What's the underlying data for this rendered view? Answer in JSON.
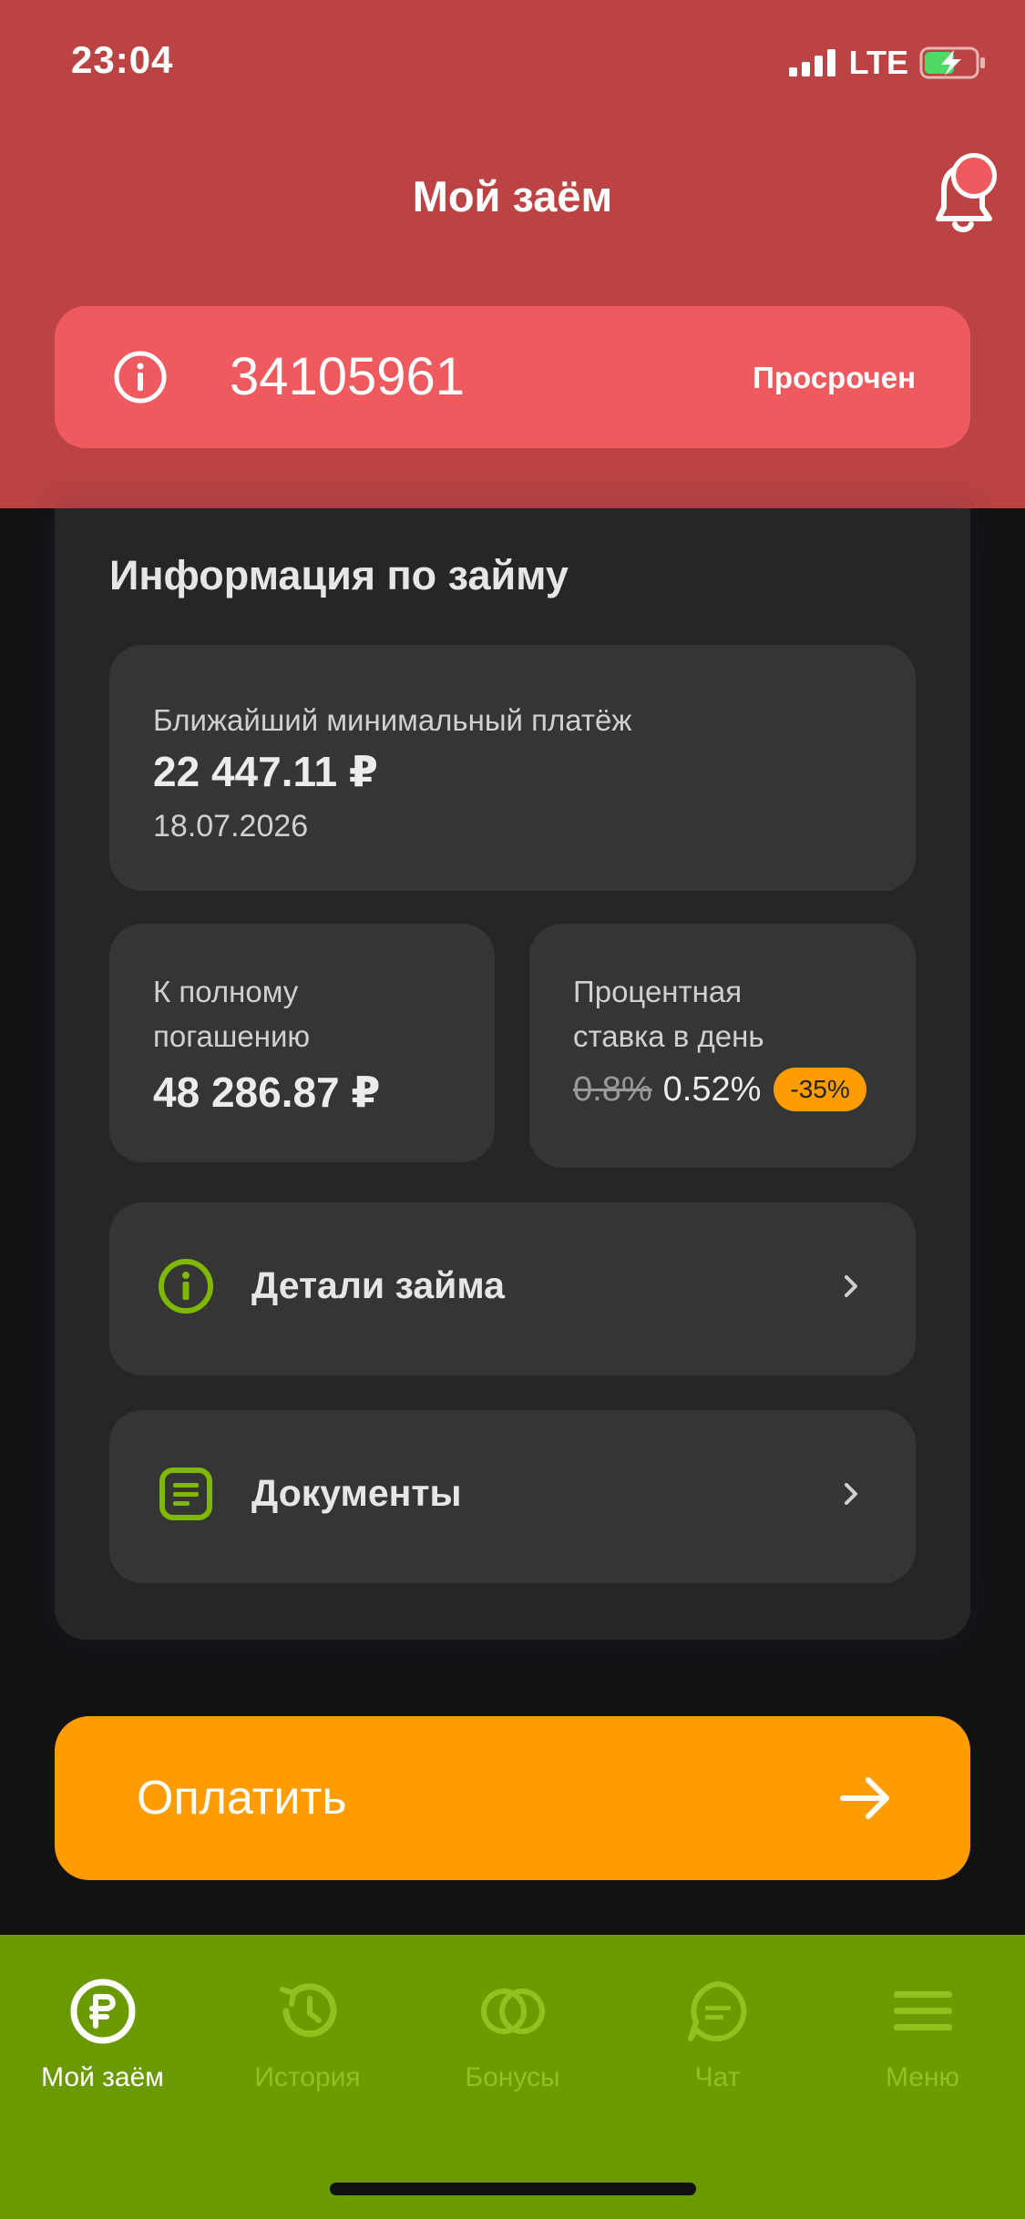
{
  "status_bar": {
    "time": "23:04",
    "network": "LTE"
  },
  "header": {
    "title": "Мой заём"
  },
  "loan": {
    "number": "34105961",
    "status": "Просрочен"
  },
  "info_card": {
    "title": "Информация по займу",
    "next_payment": {
      "label": "Ближайший минимальный платёж",
      "amount": "22 447.11 ₽",
      "date": "18.07.2026"
    },
    "full_repayment": {
      "label_line1": "К полному",
      "label_line2": "погашению",
      "amount": "48 286.87 ₽"
    },
    "daily_rate": {
      "label_line1": "Процентная",
      "label_line2": "ставка в день",
      "old_rate": "0.8%",
      "new_rate": "0.52%",
      "discount": "-35%"
    },
    "details_link": "Детали займа",
    "documents_link": "Документы"
  },
  "pay_button": {
    "label": "Оплатить"
  },
  "tabbar": {
    "items": [
      {
        "label": "Мой заём",
        "icon": "ruble-icon",
        "active": true
      },
      {
        "label": "История",
        "icon": "history-icon",
        "active": false
      },
      {
        "label": "Бонусы",
        "icon": "bonus-icon",
        "active": false
      },
      {
        "label": "Чат",
        "icon": "chat-icon",
        "active": false
      },
      {
        "label": "Меню",
        "icon": "menu-icon",
        "active": false
      }
    ]
  },
  "colors": {
    "header_bg": "#bb4343",
    "loan_bar_bg": "#ef5a5e",
    "accent_orange": "#ff9c00",
    "tabbar_bg": "#6a9a00",
    "icon_green": "#7fb800",
    "tab_inactive": "#8fc21f"
  }
}
